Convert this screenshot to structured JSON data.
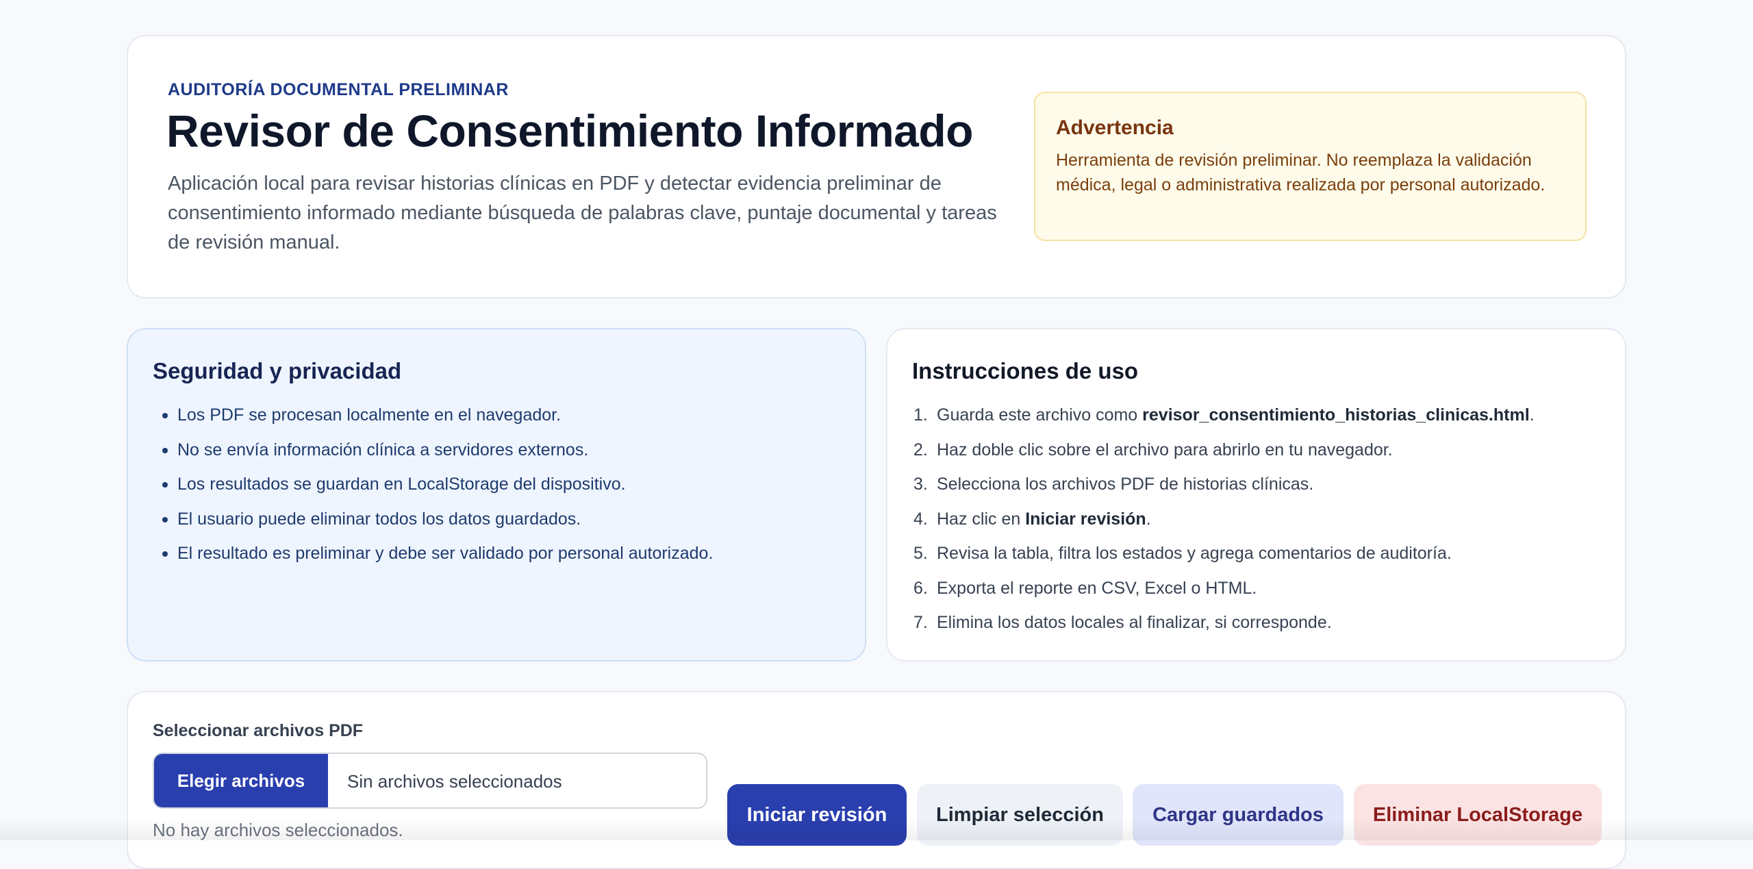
{
  "header": {
    "eyebrow": "AUDITORÍA DOCUMENTAL PRELIMINAR",
    "title": "Revisor de Consentimiento Informado",
    "description": "Aplicación local para revisar historias clínicas en PDF y detectar evidencia preliminar de consentimiento informado mediante búsqueda de palabras clave, puntaje documental y tareas de revisión manual."
  },
  "warning": {
    "title": "Advertencia",
    "text": "Herramienta de revisión preliminar. No reemplaza la validación médica, legal o administrativa realizada por personal autorizado."
  },
  "security": {
    "title": "Seguridad y privacidad",
    "items": [
      "Los PDF se procesan localmente en el navegador.",
      "No se envía información clínica a servidores externos.",
      "Los resultados se guardan en LocalStorage del dispositivo.",
      "El usuario puede eliminar todos los datos guardados.",
      "El resultado es preliminar y debe ser validado por personal autorizado."
    ]
  },
  "instructions": {
    "title": "Instrucciones de uso",
    "items": [
      {
        "num": "1.",
        "pre": "Guarda este archivo como ",
        "bold": "revisor_consentimiento_historias_clinicas.html",
        "post": "."
      },
      {
        "num": "2.",
        "pre": "Haz doble clic sobre el archivo para abrirlo en tu navegador.",
        "bold": "",
        "post": ""
      },
      {
        "num": "3.",
        "pre": "Selecciona los archivos PDF de historias clínicas.",
        "bold": "",
        "post": ""
      },
      {
        "num": "4.",
        "pre": "Haz clic en ",
        "bold": "Iniciar revisión",
        "post": "."
      },
      {
        "num": "5.",
        "pre": "Revisa la tabla, filtra los estados y agrega comentarios de auditoría.",
        "bold": "",
        "post": ""
      },
      {
        "num": "6.",
        "pre": "Exporta el reporte en CSV, Excel o HTML.",
        "bold": "",
        "post": ""
      },
      {
        "num": "7.",
        "pre": "Elimina los datos locales al finalizar, si corresponde.",
        "bold": "",
        "post": ""
      }
    ]
  },
  "files": {
    "label": "Seleccionar archivos PDF",
    "choose_label": "Elegir archivos",
    "status_text": "Sin archivos seleccionados",
    "note": "No hay archivos seleccionados.",
    "actions": {
      "start": "Iniciar revisión",
      "clear": "Limpiar selección",
      "load": "Cargar guardados",
      "delete": "Eliminar LocalStorage"
    }
  }
}
